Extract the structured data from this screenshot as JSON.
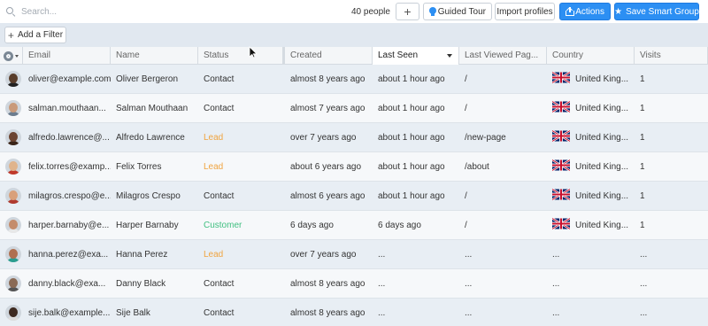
{
  "search": {
    "placeholder": "Search..."
  },
  "toolbar": {
    "people_count": "40 people",
    "add_label": "+",
    "guided_tour_label": "Guided Tour",
    "import_label": "Import profiles",
    "actions_label": "Actions",
    "save_smart_group_label": "Save Smart Group"
  },
  "filter": {
    "add_filter_label": "Add a Filter"
  },
  "colors": {
    "accent": "#2c8ff3",
    "lead": "#f0a440",
    "customer": "#3fbf80",
    "row_odd": "#e8eef4",
    "row_even": "#f6f8fa"
  },
  "table": {
    "columns": [
      "Email",
      "Name",
      "Status",
      "Created",
      "Last Seen",
      "Last Viewed Pag...",
      "Country",
      "Visits"
    ],
    "sorted_column": "Last Seen",
    "rows": [
      {
        "email": "oliver@example.com",
        "name": "Oliver Bergeron",
        "status": "Contact",
        "created": "almost 8 years ago",
        "last_seen": "about 1 hour ago",
        "last_viewed": "/",
        "country": "United King...",
        "visits": "1",
        "skin": "#5a3e2b",
        "shirt": "#222222"
      },
      {
        "email": "salman.mouthaan...",
        "name": "Salman Mouthaan",
        "status": "Contact",
        "created": "almost 7 years ago",
        "last_seen": "about 1 hour ago",
        "last_viewed": "/",
        "country": "United King...",
        "visits": "1",
        "skin": "#c99a7a",
        "shirt": "#6b7c8e"
      },
      {
        "email": "alfredo.lawrence@...",
        "name": "Alfredo Lawrence",
        "status": "Lead",
        "created": "over 7 years ago",
        "last_seen": "about 1 hour ago",
        "last_viewed": "/new-page",
        "country": "United King...",
        "visits": "1",
        "skin": "#6b4330",
        "shirt": "#3a2418"
      },
      {
        "email": "felix.torres@examp...",
        "name": "Felix Torres",
        "status": "Lead",
        "created": "about 6 years ago",
        "last_seen": "about 1 hour ago",
        "last_viewed": "/about",
        "country": "United King...",
        "visits": "1",
        "skin": "#e0b48c",
        "shirt": "#c0392b"
      },
      {
        "email": "milagros.crespo@e...",
        "name": "Milagros Crespo",
        "status": "Contact",
        "created": "almost 6 years ago",
        "last_seen": "about 1 hour ago",
        "last_viewed": "/",
        "country": "United King...",
        "visits": "1",
        "skin": "#d9a07a",
        "shirt": "#b03a2e"
      },
      {
        "email": "harper.barnaby@e...",
        "name": "Harper Barnaby",
        "status": "Customer",
        "created": "6 days ago",
        "last_seen": "6 days ago",
        "last_viewed": "/",
        "country": "United King...",
        "visits": "1",
        "skin": "#c48c6c",
        "shirt": "#e8e8e8"
      },
      {
        "email": "hanna.perez@exa...",
        "name": "Hanna Perez",
        "status": "Lead",
        "created": "over 7 years ago",
        "last_seen": "...",
        "last_viewed": "...",
        "country": "...",
        "visits": "...",
        "skin": "#b07050",
        "shirt": "#2a9d8f"
      },
      {
        "email": "danny.black@exa...",
        "name": "Danny Black",
        "status": "Contact",
        "created": "almost 8 years ago",
        "last_seen": "...",
        "last_viewed": "...",
        "country": "...",
        "visits": "...",
        "skin": "#8a6a55",
        "shirt": "#555555"
      },
      {
        "email": "sije.balk@example...",
        "name": "Sije Balk",
        "status": "Contact",
        "created": "almost 8 years ago",
        "last_seen": "...",
        "last_viewed": "...",
        "country": "...",
        "visits": "...",
        "skin": "#3e2a20",
        "shirt": "#dddddd"
      }
    ]
  }
}
